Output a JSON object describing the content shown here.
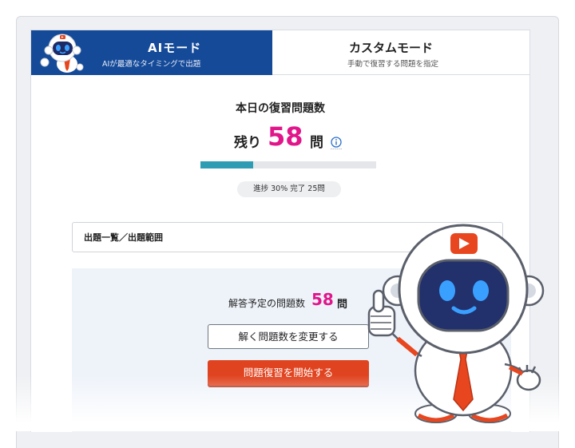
{
  "tabs": {
    "ai": {
      "title": "AIモード",
      "subtitle": "AIが最適なタイミングで出題"
    },
    "custom": {
      "title": "カスタムモード",
      "subtitle": "手動で復習する問題を指定"
    }
  },
  "today": {
    "title": "本日の復習問題数",
    "remaining_prefix": "残り",
    "remaining_count": "58",
    "remaining_unit": "問",
    "progress_percent": 30,
    "progress_text": "進捗 30%  完了 25問"
  },
  "question_list": {
    "label": "出題一覧／出題範囲"
  },
  "planned": {
    "label": "解答予定の問題数",
    "count": "58",
    "unit": "問"
  },
  "buttons": {
    "change": "解く問題数を変更する",
    "start": "問題復習を開始する"
  },
  "colors": {
    "ai_tab": "#154a99",
    "accent_pink": "#e0168a",
    "progress_fill": "#2e9db3",
    "start_button": "#e0431f"
  }
}
